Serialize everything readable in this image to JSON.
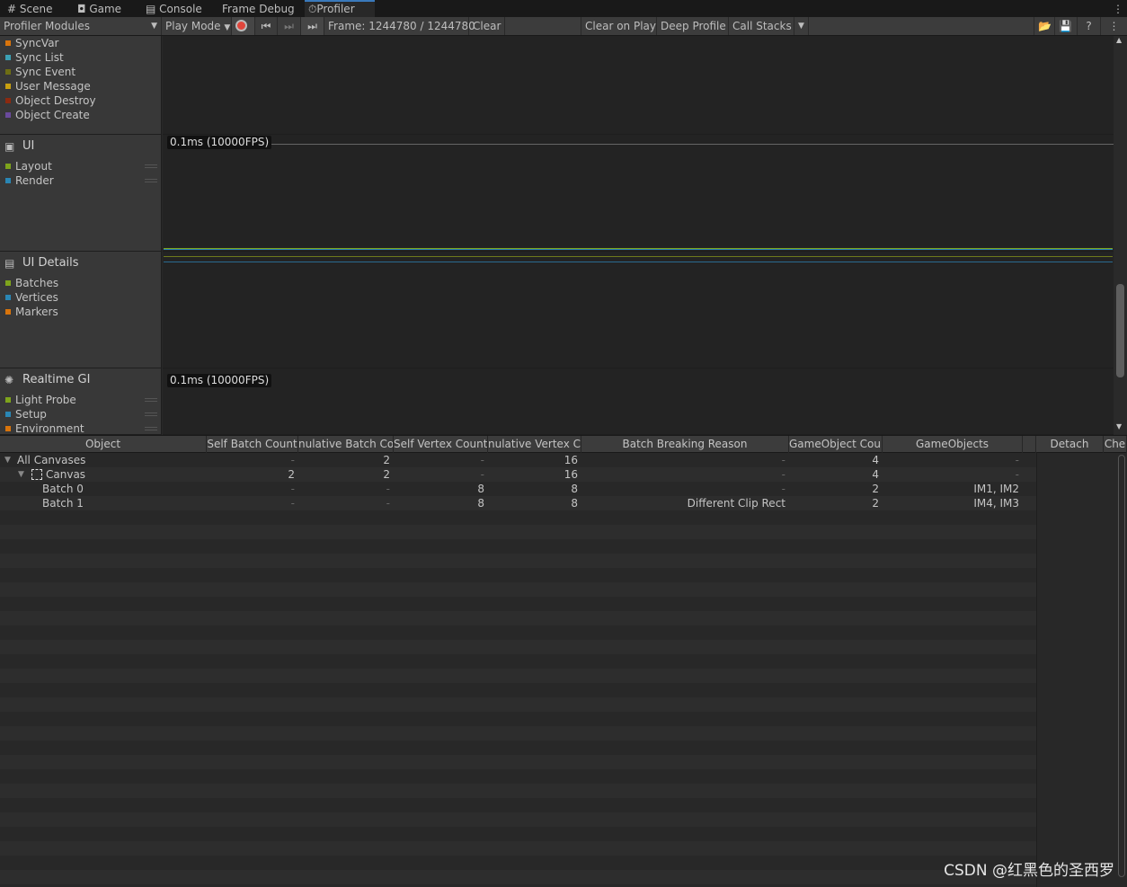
{
  "tabs": [
    {
      "label": "Scene",
      "icon": "grid-icon"
    },
    {
      "label": "Game",
      "icon": "gamepad-icon"
    },
    {
      "label": "Console",
      "icon": "console-icon"
    },
    {
      "label": "Frame Debug",
      "icon": ""
    },
    {
      "label": "Profiler",
      "icon": "stopwatch-icon",
      "active": true
    }
  ],
  "toolbar": {
    "modules": "Profiler Modules",
    "play_mode": "Play Mode",
    "frame": "Frame: 1244780 / 1244780",
    "clear": "Clear",
    "clear_on_play": "Clear on Play",
    "deep_profile": "Deep Profile",
    "call_stacks": "Call Stacks"
  },
  "modules": {
    "network": {
      "items": [
        {
          "label": "SyncVar",
          "color": "#d8740c"
        },
        {
          "label": "Sync List",
          "color": "#3ca0b4"
        },
        {
          "label": "Sync Event",
          "color": "#6e6e14"
        },
        {
          "label": "User Message",
          "color": "#c8a010"
        },
        {
          "label": "Object Destroy",
          "color": "#8c2a10"
        },
        {
          "label": "Object Create",
          "color": "#6a4a9c"
        }
      ]
    },
    "ui": {
      "title": "UI",
      "scale": "0.1ms (10000FPS)",
      "items": [
        {
          "label": "Layout",
          "color": "#7ea41c"
        },
        {
          "label": "Render",
          "color": "#2a86b4"
        }
      ]
    },
    "ui_details": {
      "title": "UI Details",
      "items": [
        {
          "label": "Batches",
          "color": "#7ea41c"
        },
        {
          "label": "Vertices",
          "color": "#2a86b4"
        },
        {
          "label": "Markers",
          "color": "#d8740c"
        }
      ]
    },
    "realtime_gi": {
      "title": "Realtime GI",
      "scale": "0.1ms (10000FPS)",
      "items": [
        {
          "label": "Light Probe",
          "color": "#7ea41c"
        },
        {
          "label": "Setup",
          "color": "#2a86b4"
        },
        {
          "label": "Environment",
          "color": "#d8740c"
        }
      ]
    }
  },
  "table": {
    "columns": [
      "Object",
      "Self Batch Count",
      "nulative Batch Co",
      "Self Vertex Count",
      "nulative Vertex Co",
      "Batch Breaking Reason",
      "GameObject Coun",
      "GameObjects",
      "",
      "Detach",
      "Che"
    ],
    "rows": [
      {
        "name": "All Canvases",
        "cells": [
          "-",
          "2",
          "-",
          "16",
          "-",
          "4",
          "-"
        ]
      },
      {
        "name": "Canvas",
        "cells": [
          "2",
          "2",
          "-",
          "16",
          "-",
          "4",
          "-"
        ]
      },
      {
        "name": "Batch 0",
        "cells": [
          "-",
          "-",
          "8",
          "8",
          "-",
          "2",
          "IM1, IM2"
        ]
      },
      {
        "name": "Batch 1",
        "cells": [
          "-",
          "-",
          "8",
          "8",
          "Different Clip Rect",
          "2",
          "IM4, IM3"
        ]
      }
    ]
  },
  "watermark": "CSDN @红黑色的圣西罗"
}
